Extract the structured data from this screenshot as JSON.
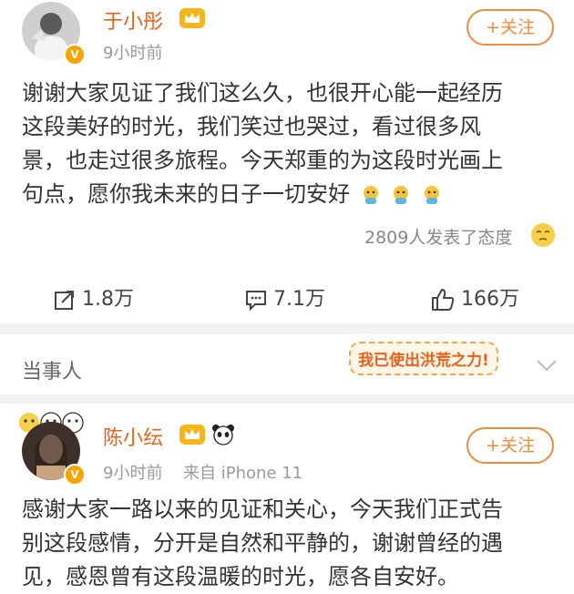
{
  "post1": {
    "author_name": "于小彤",
    "time": "9小时前",
    "follow_label": "+关注",
    "text_lines": [
      "谢谢大家见证了我们这么久，也很开心能一起经历",
      "这段美好的时光，我们笑过也哭过，看过很多风",
      "景，也走过很多旅程。今天郑重的为这段时光画上",
      "句点，愿你我未来的日子一切安好"
    ],
    "reactions_text": "2809人发表了态度",
    "repost_count": "1.8万",
    "comment_count": "7.1万",
    "like_count": "166万"
  },
  "section": {
    "label": "当事人",
    "sticker_text": "我已使出洪荒之力!"
  },
  "post2": {
    "author_name": "陈小纭",
    "time": "9小时前",
    "source": "来自 iPhone 11",
    "follow_label": "+关注",
    "text_lines": [
      "感谢大家一路以来的见证和关心，今天我们正式告",
      "别这段感情，分开是自然和平静的，谢谢曾经的遇",
      "见，感恩曾有这段温暖的时光，愿各自安好。"
    ]
  },
  "colors": {
    "name": "#e8601b",
    "follow": "#f08b3d",
    "verified": "#f7a400",
    "meta": "#999999",
    "divider": "#f2f2f2"
  }
}
